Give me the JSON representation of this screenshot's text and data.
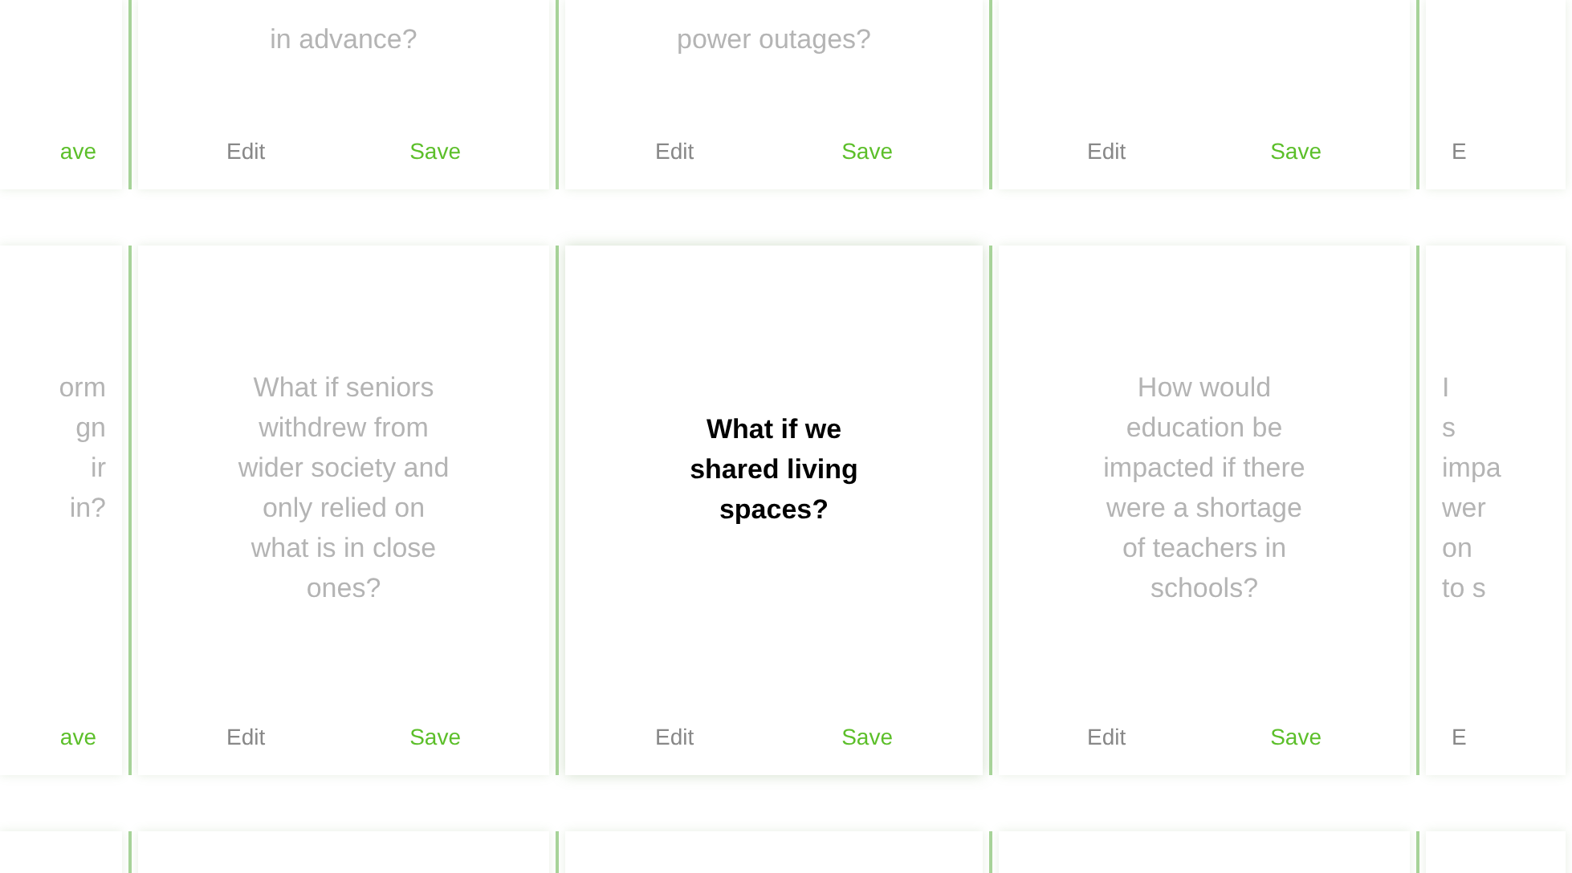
{
  "rows": [
    {
      "cards": [
        {
          "save": "ave",
          "selected": false
        },
        {
          "lines": [
            "in advance?"
          ],
          "edit": "Edit",
          "save": "Save",
          "selected": false
        },
        {
          "lines": [
            "power outages?"
          ],
          "edit": "Edit",
          "save": "Save",
          "selected": false
        },
        {
          "edit": "Edit",
          "save": "Save",
          "selected": false
        },
        {
          "edit": "E",
          "selected": false
        }
      ]
    },
    {
      "cards": [
        {
          "lines": [
            "orm",
            "gn",
            "ir",
            "in?"
          ],
          "save": "ave",
          "selected": false
        },
        {
          "lines": [
            "What if seniors",
            "withdrew from",
            "wider society and",
            "only relied on",
            "what is in close",
            "ones?"
          ],
          "edit": "Edit",
          "save": "Save",
          "selected": false
        },
        {
          "lines": [
            "What if we",
            "shared living",
            "spaces?"
          ],
          "edit": "Edit",
          "save": "Save",
          "selected": true
        },
        {
          "lines": [
            "How would",
            "education be",
            "impacted if there",
            "were a shortage",
            "of teachers in",
            "schools?"
          ],
          "edit": "Edit",
          "save": "Save",
          "selected": false
        },
        {
          "lines": [
            "I",
            "s",
            "impa",
            "wer",
            "on",
            "to s"
          ],
          "edit": "E",
          "selected": false
        }
      ]
    },
    {
      "cards": [
        {
          "selected": false
        },
        {
          "selected": false
        },
        {
          "selected": false
        },
        {
          "selected": false
        },
        {
          "selected": false
        }
      ]
    }
  ]
}
